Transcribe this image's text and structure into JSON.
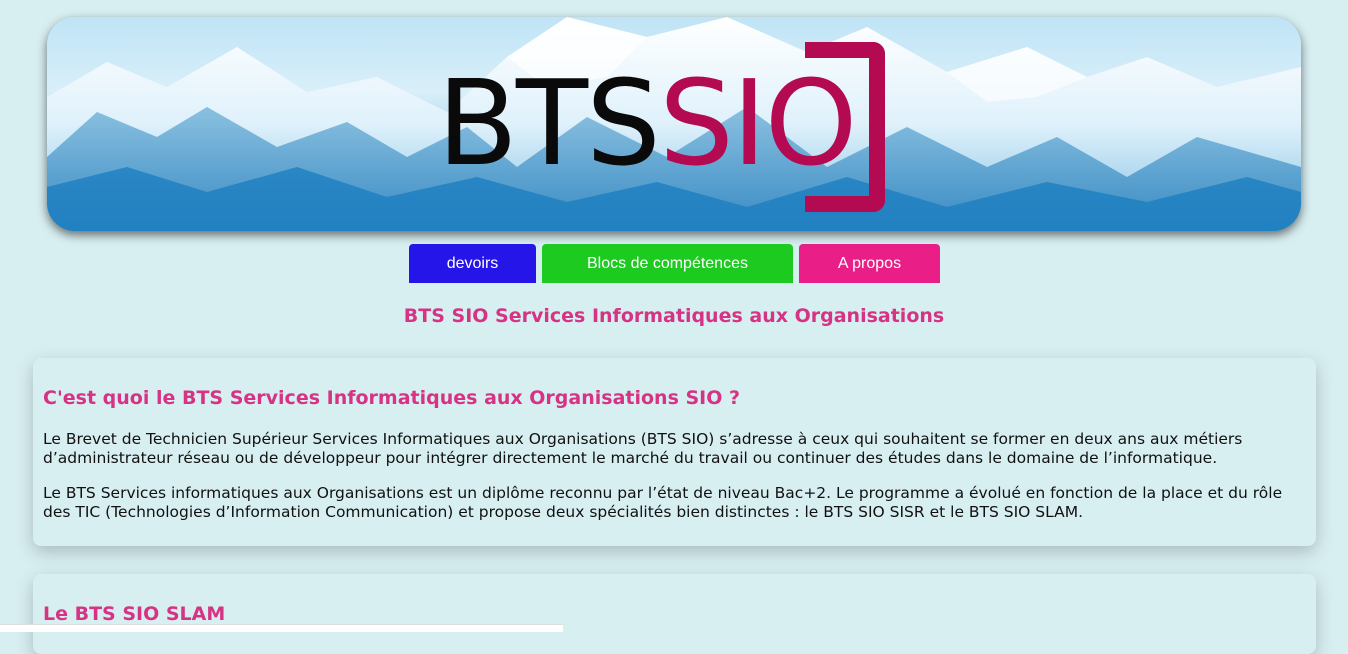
{
  "banner": {
    "logo_black": "BTS",
    "logo_red": "SIO"
  },
  "nav": {
    "devoirs": "devoirs",
    "blocs": "Blocs de compétences",
    "apropos": "A propos"
  },
  "subtitle": "BTS SIO Services Informatiques aux Organisations",
  "section1": {
    "heading": "C'est quoi le BTS Services Informatiques aux Organisations SIO ?",
    "paragraph1": "Le Brevet de Technicien Supérieur Services Informatiques aux Organisations (BTS SIO) s’adresse à ceux qui souhaitent se former en deux ans aux métiers d’administrateur réseau ou de développeur pour intégrer directement le marché du travail ou continuer des études dans le domaine de l’informatique.",
    "paragraph2": "Le BTS Services informatiques aux Organisations est un diplôme reconnu par l’état de niveau Bac+2. Le programme a évolué en fonction de la place et du rôle des TIC (Technologies d’Information Communication) et propose deux spécialités bien distinctes : le BTS SIO SISR et le BTS SIO SLAM."
  },
  "section2": {
    "heading": "Le BTS SIO SLAM"
  },
  "colors": {
    "background": "#d8eff2",
    "accent_pink": "#d63384",
    "nav_blue": "#2515e8",
    "nav_green": "#1dca1f",
    "nav_pink": "#e91e87",
    "logo_red": "#b30a52"
  },
  "icons": {
    "banner_image": "mountain-landscape"
  }
}
